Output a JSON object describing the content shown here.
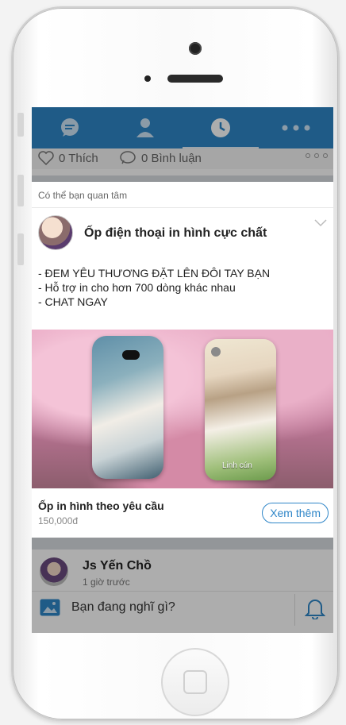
{
  "likes": {
    "like_count": "0 Thích",
    "comment_count": "0 Bình luận"
  },
  "ad": {
    "header": "Có thể bạn quan tâm",
    "title": "Ốp điện thoại in hình cực chất",
    "body": [
      "- ĐEM YÊU THƯƠNG ĐẶT LÊN ĐÔI TAY BẠN",
      "- Hỗ trợ in cho hơn 700 dòng khác nhau",
      "- CHAT NGAY"
    ],
    "image_caption": "Linh cún",
    "product_name": "Ốp in hình theo yêu cầu",
    "price": "150,000đ",
    "cta": "Xem thêm"
  },
  "post": {
    "user_name": "Js Yến Chồ",
    "time": "1 giờ trước",
    "compose_placeholder": "Bạn đang nghĩ gì?"
  },
  "icons": {
    "tab1": "chat-icon",
    "tab2": "profile-icon",
    "tab3": "clock-icon",
    "tab4": "more-icon"
  },
  "colors": {
    "accent": "#2f86c8"
  }
}
